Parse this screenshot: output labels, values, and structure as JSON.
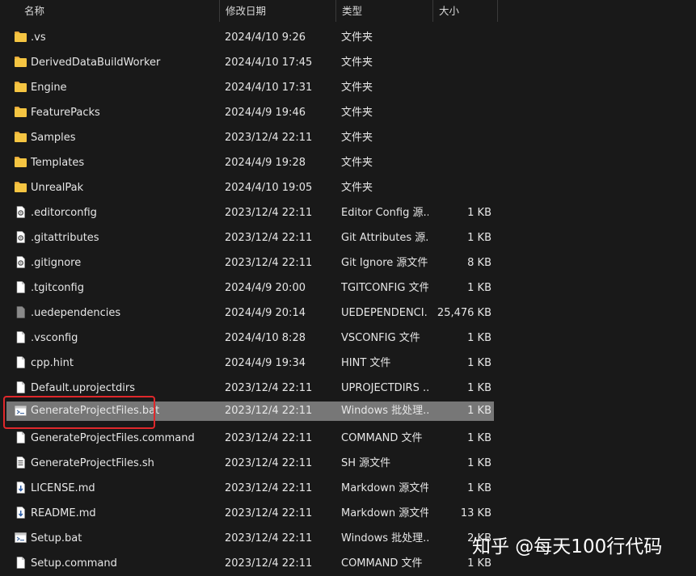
{
  "columns": {
    "name": "名称",
    "date": "修改日期",
    "type": "类型",
    "size": "大小"
  },
  "files": [
    {
      "name": ".vs",
      "date": "2024/4/10 9:26",
      "type": "文件夹",
      "size": "",
      "icon": "folder-icon"
    },
    {
      "name": "DerivedDataBuildWorker",
      "date": "2024/4/10 17:45",
      "type": "文件夹",
      "size": "",
      "icon": "folder-icon"
    },
    {
      "name": "Engine",
      "date": "2024/4/10 17:31",
      "type": "文件夹",
      "size": "",
      "icon": "folder-icon"
    },
    {
      "name": "FeaturePacks",
      "date": "2024/4/9 19:46",
      "type": "文件夹",
      "size": "",
      "icon": "folder-icon"
    },
    {
      "name": "Samples",
      "date": "2023/12/4 22:11",
      "type": "文件夹",
      "size": "",
      "icon": "folder-icon"
    },
    {
      "name": "Templates",
      "date": "2024/4/9 19:28",
      "type": "文件夹",
      "size": "",
      "icon": "folder-icon"
    },
    {
      "name": "UnrealPak",
      "date": "2024/4/10 19:05",
      "type": "文件夹",
      "size": "",
      "icon": "folder-icon"
    },
    {
      "name": ".editorconfig",
      "date": "2023/12/4 22:11",
      "type": "Editor Config 源...",
      "size": "1 KB",
      "icon": "config-file-icon"
    },
    {
      "name": ".gitattributes",
      "date": "2023/12/4 22:11",
      "type": "Git Attributes 源...",
      "size": "1 KB",
      "icon": "config-file-icon"
    },
    {
      "name": ".gitignore",
      "date": "2023/12/4 22:11",
      "type": "Git Ignore 源文件",
      "size": "8 KB",
      "icon": "config-file-icon"
    },
    {
      "name": ".tgitconfig",
      "date": "2024/4/9 20:00",
      "type": "TGITCONFIG 文件",
      "size": "1 KB",
      "icon": "file-icon"
    },
    {
      "name": ".uedependencies",
      "date": "2024/4/9 20:14",
      "type": "UEDEPENDENCI...",
      "size": "25,476 KB",
      "icon": "binary-file-icon"
    },
    {
      "name": ".vsconfig",
      "date": "2024/4/10 8:28",
      "type": "VSCONFIG 文件",
      "size": "1 KB",
      "icon": "file-icon"
    },
    {
      "name": "cpp.hint",
      "date": "2024/4/9 19:34",
      "type": "HINT 文件",
      "size": "1 KB",
      "icon": "file-icon"
    },
    {
      "name": "Default.uprojectdirs",
      "date": "2023/12/4 22:11",
      "type": "UPROJECTDIRS ...",
      "size": "1 KB",
      "icon": "file-icon"
    },
    {
      "name": "GenerateProjectFiles.bat",
      "date": "2023/12/4 22:11",
      "type": "Windows 批处理...",
      "size": "1 KB",
      "icon": "batch-file-icon",
      "selected": true
    },
    {
      "name": "GenerateProjectFiles.command",
      "date": "2023/12/4 22:11",
      "type": "COMMAND 文件",
      "size": "1 KB",
      "icon": "file-icon"
    },
    {
      "name": "GenerateProjectFiles.sh",
      "date": "2023/12/4 22:11",
      "type": "SH 源文件",
      "size": "1 KB",
      "icon": "script-file-icon"
    },
    {
      "name": "LICENSE.md",
      "date": "2023/12/4 22:11",
      "type": "Markdown 源文件",
      "size": "1 KB",
      "icon": "markdown-file-icon"
    },
    {
      "name": "README.md",
      "date": "2023/12/4 22:11",
      "type": "Markdown 源文件",
      "size": "13 KB",
      "icon": "markdown-file-icon"
    },
    {
      "name": "Setup.bat",
      "date": "2023/12/4 22:11",
      "type": "Windows 批处理...",
      "size": "2 KB",
      "icon": "batch-file-icon"
    },
    {
      "name": "Setup.command",
      "date": "2023/12/4 22:11",
      "type": "COMMAND 文件",
      "size": "1 KB",
      "icon": "file-icon"
    }
  ],
  "watermark": "知乎 @每天100行代码",
  "colors": {
    "background": "#191919",
    "selection": "#777777",
    "highlight_border": "#e0282b",
    "folder": "#f5c542"
  }
}
